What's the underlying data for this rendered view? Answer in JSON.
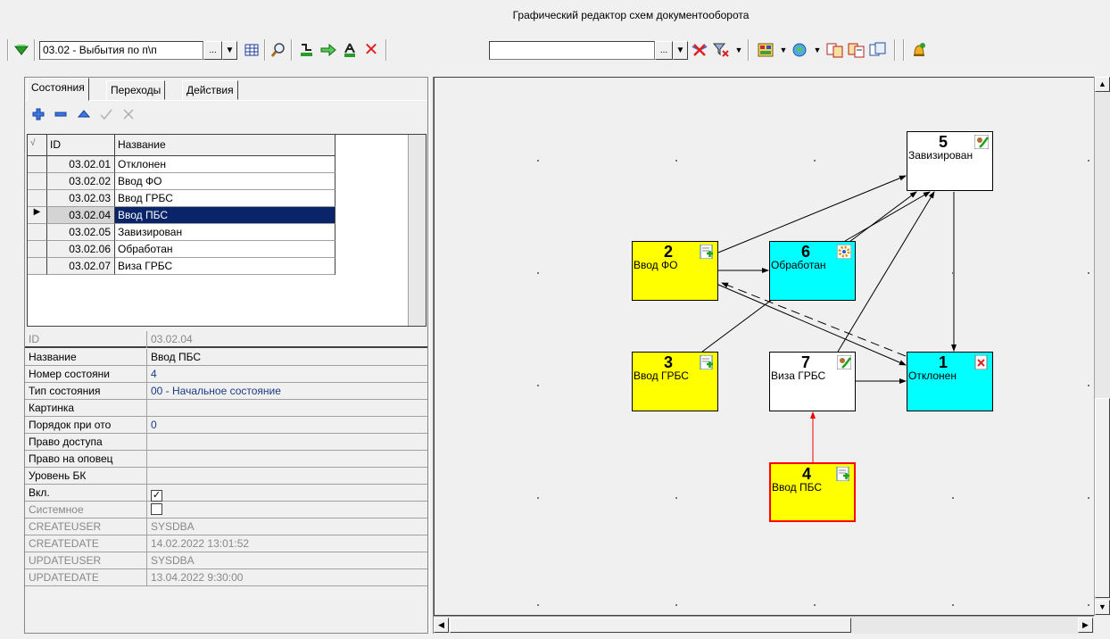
{
  "window": {
    "title": "Графический редактор схем документооборота"
  },
  "toolbar": {
    "scheme_combo_value": "03.02 - Выбытия по п\\п",
    "ellipsis_label": "...",
    "filter_combo_value": "",
    "filter_ellipsis_label": "..."
  },
  "tabs": [
    {
      "label": "Состояния"
    },
    {
      "label": "Переходы"
    },
    {
      "label": "Действия"
    }
  ],
  "grid": {
    "columns": [
      "ID",
      "Название"
    ],
    "rows": [
      {
        "id": "03.02.01",
        "name": "Отклонен"
      },
      {
        "id": "03.02.02",
        "name": "Ввод ФО"
      },
      {
        "id": "03.02.03",
        "name": "Ввод ГРБС"
      },
      {
        "id": "03.02.04",
        "name": "Ввод ПБС",
        "selected": true
      },
      {
        "id": "03.02.05",
        "name": "Завизирован"
      },
      {
        "id": "03.02.06",
        "name": "Обработан"
      },
      {
        "id": "03.02.07",
        "name": "Виза ГРБС"
      }
    ]
  },
  "properties": [
    {
      "key": "ID",
      "value": "03.02.04",
      "disabled": true
    },
    {
      "key": "Название",
      "value": "Ввод ПБС"
    },
    {
      "key": "Номер состояни",
      "value": "4",
      "blue": true
    },
    {
      "key": "Тип состояния",
      "value": "00 - Начальное состояние",
      "blue": true
    },
    {
      "key": "Картинка",
      "value": ""
    },
    {
      "key": "Порядок при ото",
      "value": "0",
      "blue": true
    },
    {
      "key": "Право доступа",
      "value": ""
    },
    {
      "key": "Право на оповец",
      "value": ""
    },
    {
      "key": "Уровень БК",
      "value": ""
    },
    {
      "key": "Вкл.",
      "value": "",
      "checkbox": true,
      "checked": true
    },
    {
      "key": "Системное",
      "value": "",
      "checkbox": true,
      "checked": false,
      "disabled": true
    },
    {
      "key": "CREATEUSER",
      "value": "SYSDBA",
      "disabled": true
    },
    {
      "key": "CREATEDATE",
      "value": "14.02.2022 13:01:52",
      "disabled": true
    },
    {
      "key": "UPDATEUSER",
      "value": "SYSDBA",
      "disabled": true
    },
    {
      "key": "UPDATEDATE",
      "value": "13.04.2022 9:30:00",
      "disabled": true
    }
  ],
  "diagram": {
    "nodes": [
      {
        "num": "5",
        "label": "Завизирован",
        "color": "#ffffff",
        "icon": "approved-icon"
      },
      {
        "num": "2",
        "label": "Ввод ФО",
        "color": "#ffff00",
        "icon": "document-add-icon"
      },
      {
        "num": "6",
        "label": "Обработан",
        "color": "#00ffff",
        "icon": "processing-icon"
      },
      {
        "num": "3",
        "label": "Ввод ГРБС",
        "color": "#ffff00",
        "icon": "document-add-icon"
      },
      {
        "num": "7",
        "label": "Виза ГРБС",
        "color": "#ffffff",
        "icon": "approved-icon"
      },
      {
        "num": "1",
        "label": "Отклонен",
        "color": "#00ffff",
        "icon": "rejected-icon"
      },
      {
        "num": "4",
        "label": "Ввод ПБС",
        "color": "#ffff00",
        "icon": "document-add-icon",
        "selected": true
      }
    ]
  },
  "colors": {
    "selection": "#0a246a",
    "selected_node_border": "#ff0000",
    "yellow": "#ffff00",
    "cyan": "#00ffff"
  }
}
